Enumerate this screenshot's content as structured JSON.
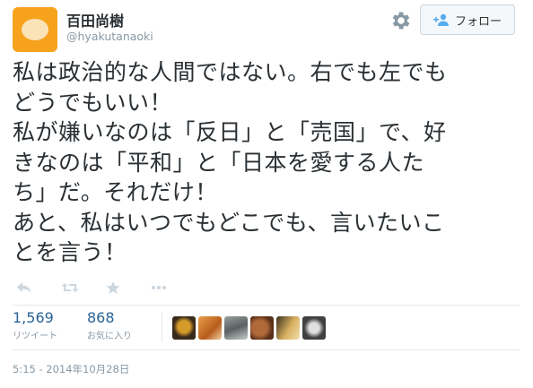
{
  "user": {
    "display_name": "百田尚樹",
    "screen_name": "@hyakutanaoki"
  },
  "follow_button": {
    "label": "フォロー"
  },
  "tweet": {
    "lines": [
      "私は政治的な人間ではない。右でも左でも",
      "どうでもいい！",
      "私が嫌いなのは「反日」と「売国」で、好",
      "きなのは「平和」と「日本を愛する人た",
      "ち」だ。それだけ！",
      "あと、私はいつでもどこでも、言いたいこ",
      "とを言う！"
    ]
  },
  "stats": {
    "retweets": {
      "count": "1,569",
      "label": "リツイート"
    },
    "favorites": {
      "count": "868",
      "label": "お気に入り"
    }
  },
  "timestamp": "5:15 - 2014年10月28日",
  "colors": {
    "avatar_bg": "#f7a21c",
    "link": "#2a6496",
    "muted": "#8899a6",
    "text": "#292f33"
  },
  "icons": [
    "gear-icon",
    "add-user-icon",
    "reply-icon",
    "retweet-icon",
    "favorite-icon",
    "more-icon"
  ]
}
